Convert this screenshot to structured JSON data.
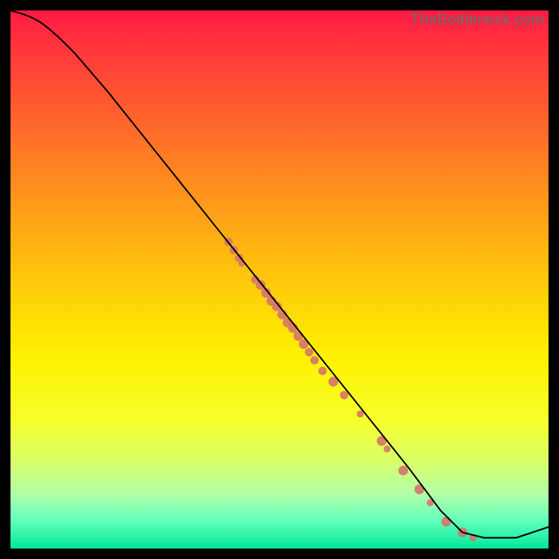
{
  "watermark": "TheBottleneck.com",
  "chart_data": {
    "type": "line",
    "title": "",
    "xlabel": "",
    "ylabel": "",
    "xlim": [
      0,
      100
    ],
    "ylim": [
      0,
      100
    ],
    "curve": {
      "x": [
        0,
        4,
        8,
        12,
        18,
        26,
        34,
        42,
        50,
        58,
        66,
        74,
        80,
        84,
        88,
        94,
        100
      ],
      "y": [
        100,
        99,
        96,
        92,
        85,
        75,
        65,
        55,
        45,
        35,
        25,
        15,
        7,
        3,
        2,
        2,
        4
      ]
    },
    "points": [
      {
        "x": 40.5,
        "y": 57,
        "r": 6
      },
      {
        "x": 41.5,
        "y": 55.5,
        "r": 6
      },
      {
        "x": 42.5,
        "y": 54,
        "r": 6
      },
      {
        "x": 43.0,
        "y": 53,
        "r": 5
      },
      {
        "x": 45.5,
        "y": 50,
        "r": 6
      },
      {
        "x": 46.5,
        "y": 49,
        "r": 7
      },
      {
        "x": 47.5,
        "y": 47.5,
        "r": 7
      },
      {
        "x": 48.5,
        "y": 46,
        "r": 7
      },
      {
        "x": 49.5,
        "y": 45,
        "r": 7
      },
      {
        "x": 50.5,
        "y": 43.5,
        "r": 7
      },
      {
        "x": 51.5,
        "y": 42,
        "r": 7
      },
      {
        "x": 52.5,
        "y": 41,
        "r": 7
      },
      {
        "x": 53.5,
        "y": 39.5,
        "r": 7
      },
      {
        "x": 54.5,
        "y": 38,
        "r": 7
      },
      {
        "x": 55.5,
        "y": 36.5,
        "r": 6
      },
      {
        "x": 56.5,
        "y": 35,
        "r": 6
      },
      {
        "x": 58.0,
        "y": 33,
        "r": 6
      },
      {
        "x": 60.0,
        "y": 31,
        "r": 7
      },
      {
        "x": 62.0,
        "y": 28.5,
        "r": 6
      },
      {
        "x": 65.0,
        "y": 25,
        "r": 5
      },
      {
        "x": 69.0,
        "y": 20,
        "r": 7
      },
      {
        "x": 70.0,
        "y": 18.5,
        "r": 5
      },
      {
        "x": 73.0,
        "y": 14.5,
        "r": 7
      },
      {
        "x": 76.0,
        "y": 11,
        "r": 7
      },
      {
        "x": 78.0,
        "y": 8.5,
        "r": 5
      },
      {
        "x": 81.0,
        "y": 5,
        "r": 7
      },
      {
        "x": 84.0,
        "y": 3,
        "r": 7
      },
      {
        "x": 86.0,
        "y": 2,
        "r": 5
      }
    ],
    "colors": {
      "curve": "#000000",
      "points": "#d6746a"
    }
  }
}
